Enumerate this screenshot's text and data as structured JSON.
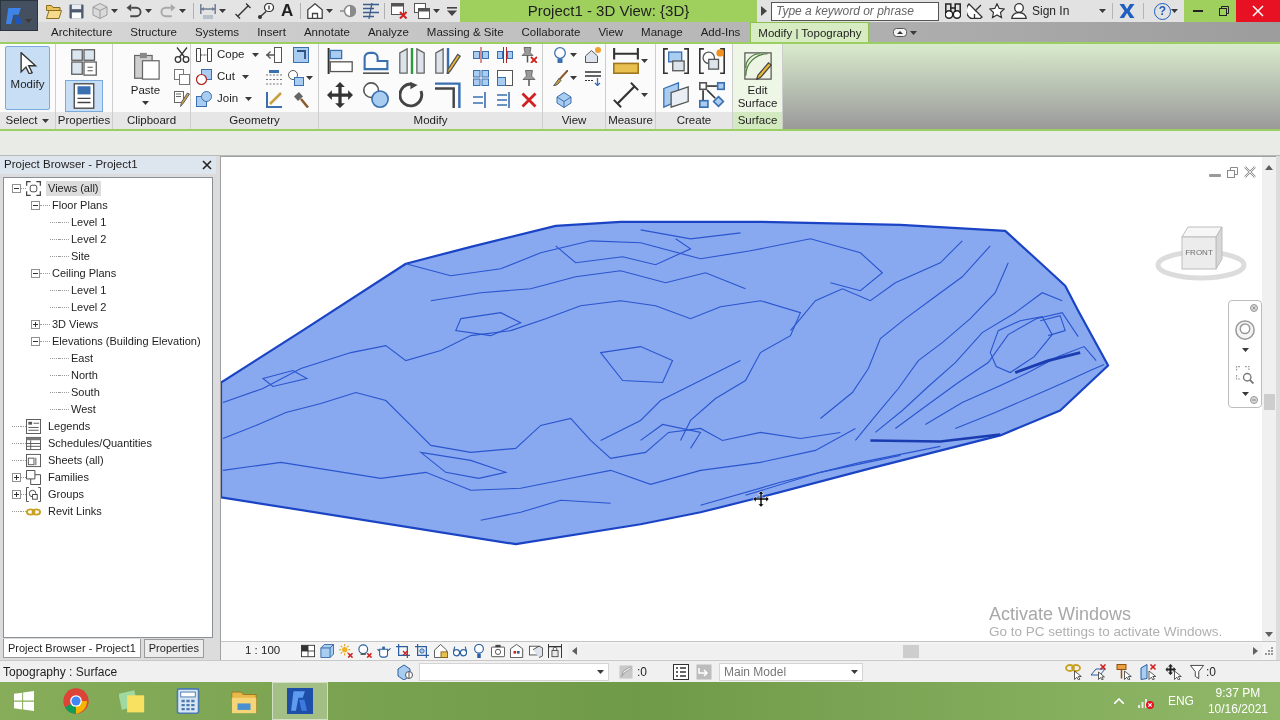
{
  "quick_access_toolbar": {
    "text_tool": "A"
  },
  "window": {
    "title": "Project1 - 3D View: {3D}"
  },
  "search": {
    "placeholder": "Type a keyword or phrase"
  },
  "account": {
    "label": "Sign In"
  },
  "help": {
    "label": "?"
  },
  "ribbon_tabs": [
    {
      "label": "Architecture",
      "selected": false
    },
    {
      "label": "Structure",
      "selected": false
    },
    {
      "label": "Systems",
      "selected": false
    },
    {
      "label": "Insert",
      "selected": false
    },
    {
      "label": "Annotate",
      "selected": false
    },
    {
      "label": "Analyze",
      "selected": false
    },
    {
      "label": "Massing & Site",
      "selected": false
    },
    {
      "label": "Collaborate",
      "selected": false
    },
    {
      "label": "View",
      "selected": false
    },
    {
      "label": "Manage",
      "selected": false
    },
    {
      "label": "Add-Ins",
      "selected": false
    },
    {
      "label": "Modify | Topography",
      "selected": true
    }
  ],
  "ribbon_panels": [
    {
      "label": "Select",
      "contextual": false,
      "dropdown": true,
      "tools": [
        {
          "kind": "large",
          "label": "Modify",
          "selected": true
        }
      ]
    },
    {
      "label": "Properties",
      "contextual": false,
      "tools": [
        {
          "kind": "icon",
          "selected": false
        },
        {
          "kind": "icon",
          "selected": true
        }
      ]
    },
    {
      "label": "Clipboard",
      "contextual": false,
      "tools": [
        {
          "kind": "large-split",
          "label": "Paste",
          "selected": false
        }
      ]
    },
    {
      "label": "Geometry",
      "contextual": false,
      "tools": [
        {
          "kind": "split",
          "label": "Cope"
        },
        {
          "kind": "split",
          "label": "Cut"
        },
        {
          "kind": "split",
          "label": "Join"
        }
      ]
    },
    {
      "label": "Modify",
      "contextual": false
    },
    {
      "label": "View",
      "contextual": false
    },
    {
      "label": "Measure",
      "contextual": false
    },
    {
      "label": "Create",
      "contextual": false
    },
    {
      "label": "Surface",
      "contextual": true,
      "tools": [
        {
          "kind": "large",
          "label": "Edit Surface",
          "selected": false
        }
      ]
    }
  ],
  "project_browser": {
    "title": "Project Browser - Project1",
    "tree": [
      {
        "label": "Views (all)",
        "kind": "views",
        "selected": true,
        "expanded": true,
        "children": [
          {
            "label": "Floor Plans",
            "selected": false,
            "expanded": true,
            "children": [
              {
                "label": "Level 1",
                "selected": false
              },
              {
                "label": "Level 2",
                "selected": false
              },
              {
                "label": "Site",
                "selected": false
              }
            ]
          },
          {
            "label": "Ceiling Plans",
            "selected": false,
            "expanded": true,
            "children": [
              {
                "label": "Level 1",
                "selected": false
              },
              {
                "label": "Level 2",
                "selected": false
              }
            ]
          },
          {
            "label": "3D Views",
            "selected": false,
            "expanded": false
          },
          {
            "label": "Elevations (Building Elevation)",
            "selected": false,
            "expanded": true,
            "children": [
              {
                "label": "East",
                "selected": false
              },
              {
                "label": "North",
                "selected": false
              },
              {
                "label": "South",
                "selected": false
              },
              {
                "label": "West",
                "selected": false
              }
            ]
          }
        ]
      },
      {
        "label": "Legends",
        "kind": "legend",
        "selected": false
      },
      {
        "label": "Schedules/Quantities",
        "kind": "schedule",
        "selected": false
      },
      {
        "label": "Sheets (all)",
        "kind": "sheet",
        "selected": false
      },
      {
        "label": "Families",
        "kind": "family",
        "selected": false,
        "expanded": false
      },
      {
        "label": "Groups",
        "kind": "group",
        "selected": false,
        "expanded": false
      },
      {
        "label": "Revit Links",
        "kind": "link",
        "selected": false
      }
    ]
  },
  "dock_tabs": [
    {
      "label": "Project Browser - Project1",
      "selected": true
    },
    {
      "label": "Properties",
      "selected": false
    }
  ],
  "view_cube": {
    "face": "FRONT"
  },
  "view_control_bar": {
    "scale": "1 : 100"
  },
  "activation_notice": {
    "title": "Activate Windows",
    "subtitle": "Go to PC settings to activate Windows."
  },
  "status_bar": {
    "selection": "Topography : Surface",
    "editing_count": ":0",
    "model": "Main Model",
    "filter_count": ":0"
  },
  "taskbar": {
    "apps": [
      {
        "kind": "start",
        "selected": false
      },
      {
        "kind": "browser",
        "selected": false
      },
      {
        "kind": "notes",
        "selected": false
      },
      {
        "kind": "calculator",
        "selected": false
      },
      {
        "kind": "files",
        "selected": false
      },
      {
        "kind": "revit",
        "selected": true
      }
    ],
    "language": "ENG",
    "time": "9:37 PM",
    "date": "10/16/2021"
  }
}
